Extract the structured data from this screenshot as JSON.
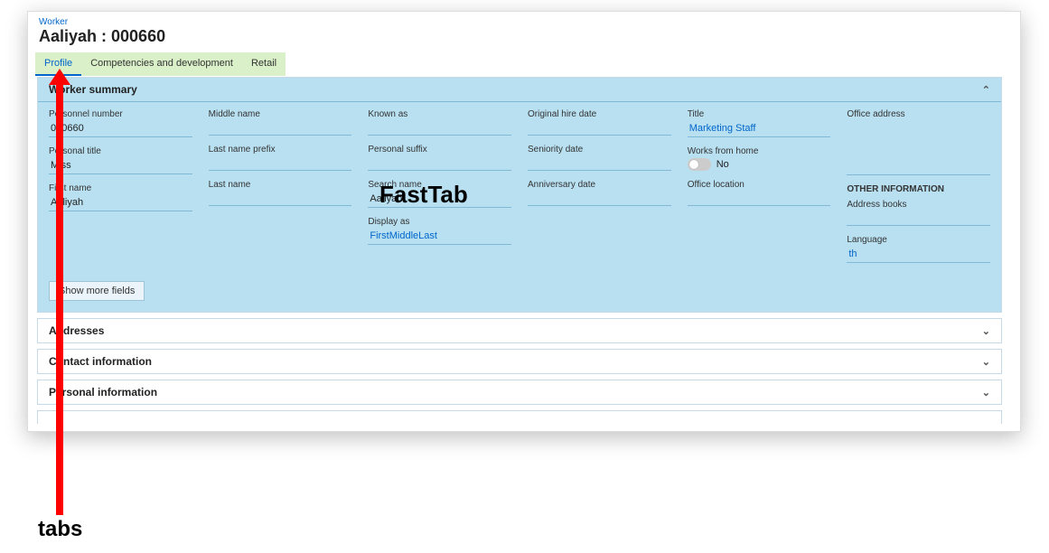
{
  "breadcrumb": "Worker",
  "page_title": "Aaliyah : 000660",
  "tabs": [
    {
      "label": "Profile",
      "active": true
    },
    {
      "label": "Competencies and development",
      "active": false
    },
    {
      "label": "Retail",
      "active": false
    }
  ],
  "worker_summary": {
    "title": "Worker summary",
    "show_more": "Show more fields",
    "cols": {
      "c1": {
        "personnel_number": {
          "label": "Personnel number",
          "value": "000660"
        },
        "personal_title": {
          "label": "Personal title",
          "value": "Miss"
        },
        "first_name": {
          "label": "First name",
          "value": "Aaliyah"
        }
      },
      "c2": {
        "middle_name": {
          "label": "Middle name",
          "value": ""
        },
        "last_name_prefix": {
          "label": "Last name prefix",
          "value": ""
        },
        "last_name": {
          "label": "Last name",
          "value": ""
        }
      },
      "c3": {
        "known_as": {
          "label": "Known as",
          "value": ""
        },
        "personal_suffix": {
          "label": "Personal suffix",
          "value": ""
        },
        "search_name": {
          "label": "Search name",
          "value": "Aaliyah"
        },
        "display_as": {
          "label": "Display as",
          "value": "FirstMiddleLast"
        }
      },
      "c4": {
        "original_hire_date": {
          "label": "Original hire date",
          "value": ""
        },
        "seniority_date": {
          "label": "Seniority date",
          "value": ""
        },
        "anniversary_date": {
          "label": "Anniversary date",
          "value": ""
        }
      },
      "c5": {
        "title": {
          "label": "Title",
          "value": "Marketing Staff"
        },
        "works_from_home": {
          "label": "Works from home",
          "value": "No"
        },
        "office_location": {
          "label": "Office location",
          "value": ""
        }
      },
      "c6": {
        "office_address": {
          "label": "Office address",
          "value": ""
        },
        "other_info_hdr": "OTHER INFORMATION",
        "address_books": {
          "label": "Address books",
          "value": ""
        },
        "language": {
          "label": "Language",
          "value": "th"
        }
      }
    }
  },
  "collapsed_fasttabs": [
    "Addresses",
    "Contact information",
    "Personal information"
  ],
  "annotations": {
    "fasttab": "FastTab",
    "tabs": "tabs"
  }
}
